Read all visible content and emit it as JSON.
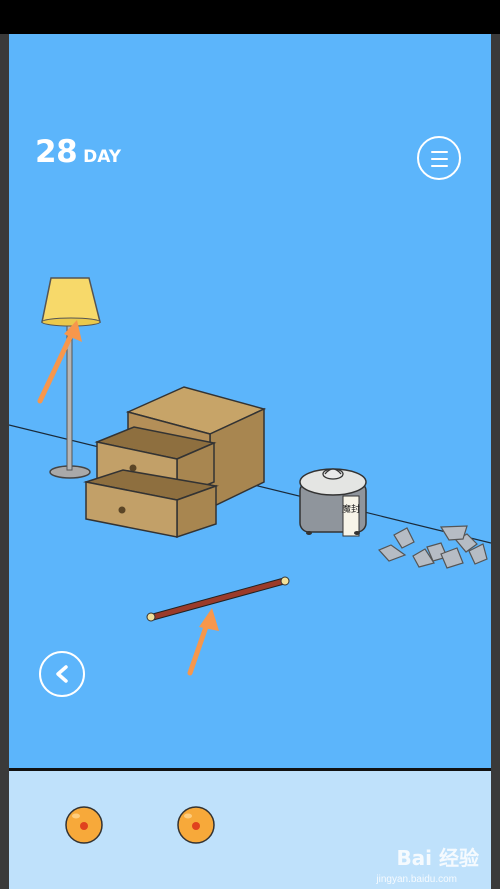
{
  "hud": {
    "day_number": "28",
    "day_label": "DAY"
  },
  "scene": {
    "objects": [
      "floor-lamp-icon",
      "wooden-drawer-cabinet",
      "rice-cooker-icon",
      "broken-pottery-shards",
      "red-stick"
    ],
    "rice_cooker_label": "魔封",
    "hint_arrows": 2
  },
  "inventory": {
    "items": [
      {
        "icon": "orange-ball-icon"
      },
      {
        "icon": "orange-ball-icon"
      }
    ]
  },
  "watermark": {
    "text": "Bai 经验",
    "sub": "jingyan.baidu.com"
  },
  "colors": {
    "sky": "#5cb5fb",
    "inventory_bg": "#bfe1fb",
    "arrow": "#f7974c",
    "wood": "#b8945a"
  }
}
